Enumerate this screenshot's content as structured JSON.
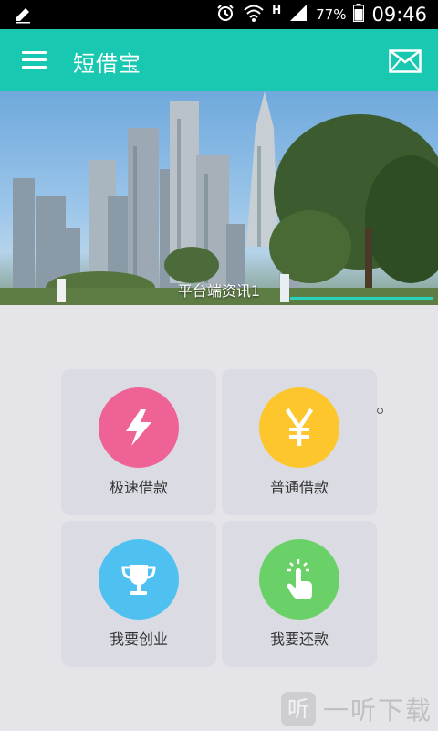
{
  "status_bar": {
    "network": "H",
    "battery": "77%",
    "time": "09:46"
  },
  "app_bar": {
    "title": "短借宝"
  },
  "banner": {
    "caption": "平台端资讯1"
  },
  "tiles": [
    {
      "label": "极速借款",
      "icon": "lightning-icon",
      "color": "#ef6295"
    },
    {
      "label": "普通借款",
      "icon": "yen-icon",
      "color": "#fdc62d"
    },
    {
      "label": "我要创业",
      "icon": "trophy-icon",
      "color": "#4ec1f1"
    },
    {
      "label": "我要还款",
      "icon": "tap-icon",
      "color": "#69d167"
    }
  ],
  "watermark": {
    "logo": "听",
    "text": "一听下载"
  }
}
